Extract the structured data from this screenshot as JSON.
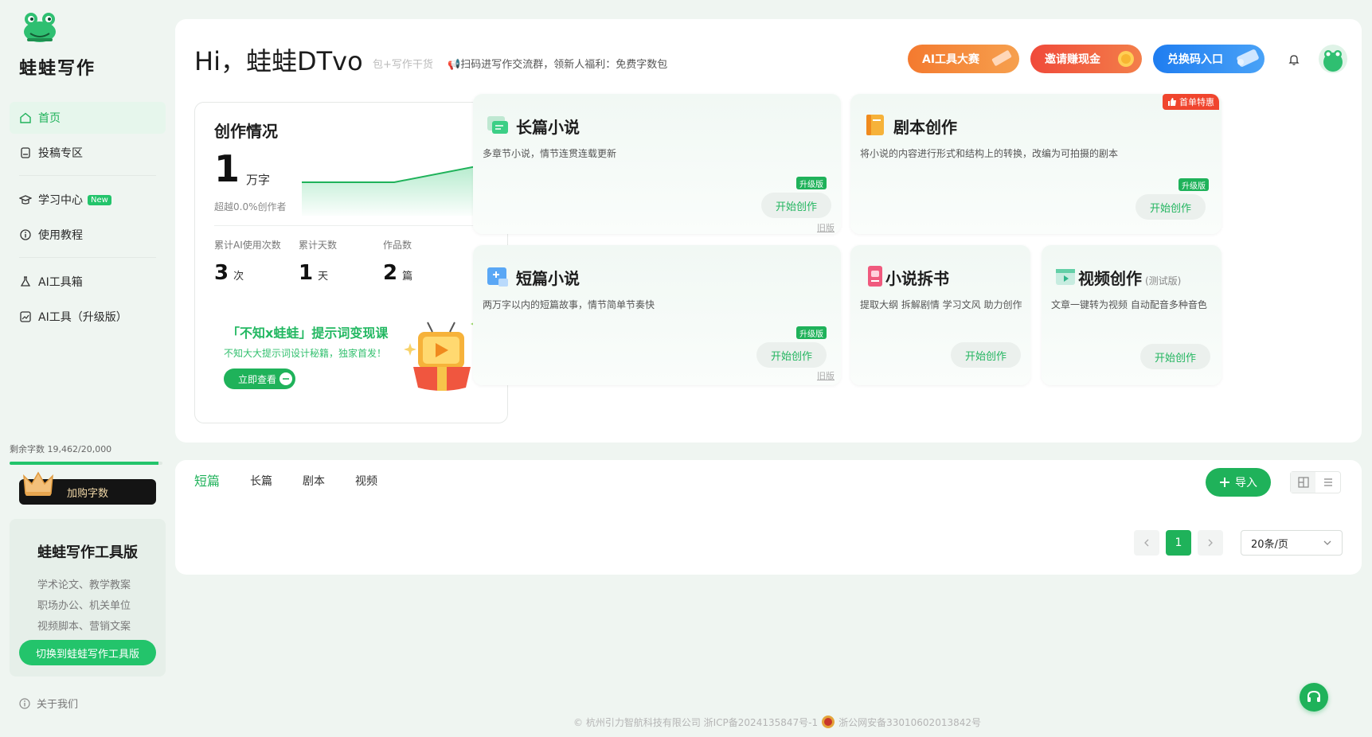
{
  "app": {
    "name": "蛙蛙写作"
  },
  "sidebar": {
    "items": [
      {
        "label": "首页",
        "icon": "home-icon",
        "active": true
      },
      {
        "label": "投稿专区",
        "icon": "submit-icon"
      },
      {
        "label": "学习中心",
        "icon": "graduation-cap-icon",
        "badge": "New"
      },
      {
        "label": "使用教程",
        "icon": "info-icon"
      },
      {
        "label": "AI工具箱",
        "icon": "flask-icon"
      },
      {
        "label": "AI工具（升级版）",
        "icon": "image-tool-icon"
      }
    ],
    "words_left_label": "剩余字数",
    "words_left_value": "19,462/20,000",
    "words_left_fraction": 0.973,
    "buy_button": "加购字数",
    "promo": {
      "title": "蛙蛙写作工具版",
      "lines": [
        "学术论文、教学教案",
        "职场办公、机关单位",
        "视频脚本、营销文案"
      ],
      "button": "切换到蛙蛙写作工具版"
    },
    "about": "关于我们"
  },
  "header": {
    "greeting": "Hi，蛙蛙DTvo",
    "ticker_faded": "包+写作干货",
    "ticker": "📢扫码进写作交流群，领新人福利：免费字数包",
    "buttons": [
      {
        "label": "AI工具大赛",
        "color": "#f47a2f"
      },
      {
        "label": "邀请赚现金",
        "color": "#f04a3a"
      },
      {
        "label": "兑换码入口",
        "color": "#1f7df0"
      }
    ]
  },
  "stats": {
    "title": "创作情况",
    "total_words": "1",
    "total_words_unit": "万字",
    "beyond": "超越0.0%创作者",
    "ai_uses_label": "累计AI使用次数",
    "ai_uses": "3",
    "ai_uses_unit": "次",
    "days_label": "累计天数",
    "days": "1",
    "days_unit": "天",
    "works_label": "作品数",
    "works": "2",
    "works_unit": "篇",
    "course_title": "「不知x蛙蛙」提示词变现课",
    "course_sub": "不知大大提示词设计秘籍，独家首发！",
    "course_button": "立即查看"
  },
  "tiles": {
    "long_novel": {
      "title": "长篇小说",
      "desc": "多章节小说，情节连贯连载更新",
      "button": "开始创作",
      "upgrade": "升级版",
      "old": "旧版"
    },
    "script": {
      "title": "剧本创作",
      "desc": "将小说的内容进行形式和结构上的转换，改编为可拍摄的剧本",
      "button": "开始创作",
      "upgrade": "升级版",
      "badge": "首单特惠"
    },
    "short_novel": {
      "title": "短篇小说",
      "desc": "两万字以内的短篇故事，情节简单节奏快",
      "button": "开始创作",
      "upgrade": "升级版",
      "old": "旧版"
    },
    "breakdown": {
      "title": "小说拆书",
      "desc": "提取大纲 拆解剧情 学习文风 助力创作",
      "button": "开始创作"
    },
    "video": {
      "title": "视频创作",
      "tag": "(测试版)",
      "desc": "文章一键转为视频 自动配音多种音色",
      "button": "开始创作"
    }
  },
  "list": {
    "tabs": [
      "短篇",
      "长篇",
      "剧本",
      "视频"
    ],
    "active_tab": 0,
    "import_button": "导入",
    "current_page": "1",
    "page_size": "20条/页"
  },
  "footer": {
    "company": "© 杭州引力智航科技有限公司 浙ICP备2024135847号-1",
    "police": "浙公网安备33010602013842号"
  }
}
